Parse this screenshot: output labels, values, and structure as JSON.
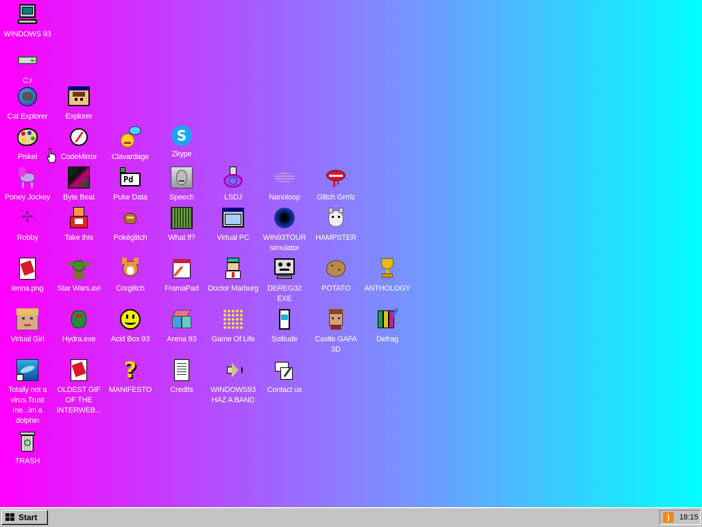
{
  "desktop": {
    "icons": [
      {
        "label": "WINDOWS 93",
        "icon": "computer-icon"
      },
      {
        "label": "C:/",
        "icon": "drive-icon"
      },
      {
        "label": "Cat Explorer",
        "icon": "cat-globe-icon"
      },
      {
        "label": "Explorer",
        "icon": "explorer-window-icon"
      },
      {
        "label": "Piskel",
        "icon": "palette-icon"
      },
      {
        "label": "CodeMirror",
        "icon": "codemirror-icon"
      },
      {
        "label": "Clavardage",
        "icon": "chat-icon"
      },
      {
        "label": "Zkype",
        "icon": "zkype-icon"
      },
      {
        "label": "Poney Jockey",
        "icon": "pony-icon"
      },
      {
        "label": "Byte Beat",
        "icon": "bytebeat-icon"
      },
      {
        "label": "Puke Data",
        "icon": "puredata-icon"
      },
      {
        "label": "Speech",
        "icon": "speech-face-icon"
      },
      {
        "label": "LSDJ",
        "icon": "lsdj-icon"
      },
      {
        "label": "Nanoloop",
        "icon": "nanoloop-icon"
      },
      {
        "label": "Glitch Grrrlz",
        "icon": "lips-icon"
      },
      {
        "label": "Robby",
        "icon": "robot-icon"
      },
      {
        "label": "Take this",
        "icon": "take-this-icon"
      },
      {
        "label": "Pokéglitch",
        "icon": "pokeglitch-icon"
      },
      {
        "label": "What If?",
        "icon": "whatif-icon"
      },
      {
        "label": "Virtual PC",
        "icon": "virtual-pc-icon"
      },
      {
        "label": "WIN93TOUR simulator",
        "icon": "tour-icon"
      },
      {
        "label": "HAMPSTER",
        "icon": "hampster-icon"
      },
      {
        "label": "lenna.png",
        "icon": "image-file-icon"
      },
      {
        "label": "Star Wars.avi",
        "icon": "yoda-icon"
      },
      {
        "label": "Corglitch",
        "icon": "corgi-icon"
      },
      {
        "label": "FramaPad",
        "icon": "framapad-icon"
      },
      {
        "label": "Doctor Marburg",
        "icon": "doctor-icon"
      },
      {
        "label": "DEREG32 EXE",
        "icon": "dereg-icon"
      },
      {
        "label": "POTATO",
        "icon": "potato-icon"
      },
      {
        "label": "ANTHOLOGY",
        "icon": "trophy-icon"
      },
      {
        "label": "Virtual Girl",
        "icon": "virtual-girl-icon"
      },
      {
        "label": "Hydra.exe",
        "icon": "hydra-icon"
      },
      {
        "label": "Acid Box 93",
        "icon": "smiley-icon"
      },
      {
        "label": "Arena 93",
        "icon": "cube-icon"
      },
      {
        "label": "Game Of Life",
        "icon": "game-of-life-icon"
      },
      {
        "label": "Solitude",
        "icon": "solitude-icon"
      },
      {
        "label": "Castle GAFA 3D",
        "icon": "castle-icon"
      },
      {
        "label": "Defrag",
        "icon": "defrag-icon"
      },
      {
        "label": "Totally not a virus.Trust me...im a dolphin",
        "icon": "dolphin-icon"
      },
      {
        "label": "OLDEST GIF OF THE INTERWEB...",
        "icon": "gif-file-icon"
      },
      {
        "label": "MANIFESTO",
        "icon": "question-icon"
      },
      {
        "label": "Credits",
        "icon": "document-icon"
      },
      {
        "label": "WINDOWS93 HAZ A BAND",
        "icon": "speaker-icon"
      },
      {
        "label": "Contact us",
        "icon": "contact-icon"
      },
      {
        "label": "TRASH",
        "icon": "trash-icon"
      }
    ]
  },
  "taskbar": {
    "start_label": "Start",
    "clock": "18:15",
    "tray_icon": "rss-icon"
  }
}
